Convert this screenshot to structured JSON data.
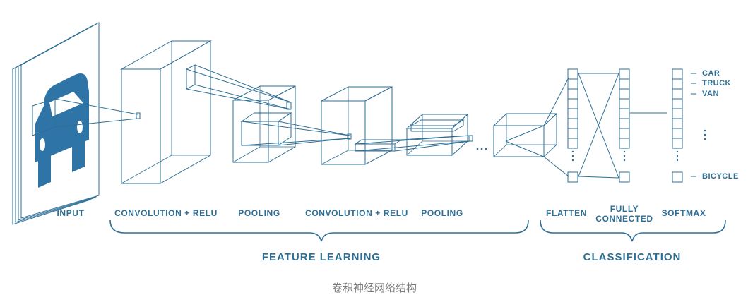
{
  "stages": {
    "input": "INPUT",
    "conv1": "CONVOLUTION + RELU",
    "pool1": "POOLING",
    "conv2": "CONVOLUTION + RELU",
    "pool2": "POOLING",
    "flatten": "FLATTEN",
    "fully_connected_line1": "FULLY",
    "fully_connected_line2": "CONNECTED",
    "softmax": "SOFTMAX"
  },
  "groups": {
    "feature_learning": "FEATURE LEARNING",
    "classification": "CLASSIFICATION"
  },
  "classes": {
    "car": "CAR",
    "truck": "TRUCK",
    "van": "VAN",
    "bicycle": "BICYCLE"
  },
  "caption": "卷积神经网络结构",
  "colors": {
    "line": "#2e6f96",
    "car_fill": "#2f74a6",
    "caption": "#7a7a7a"
  }
}
